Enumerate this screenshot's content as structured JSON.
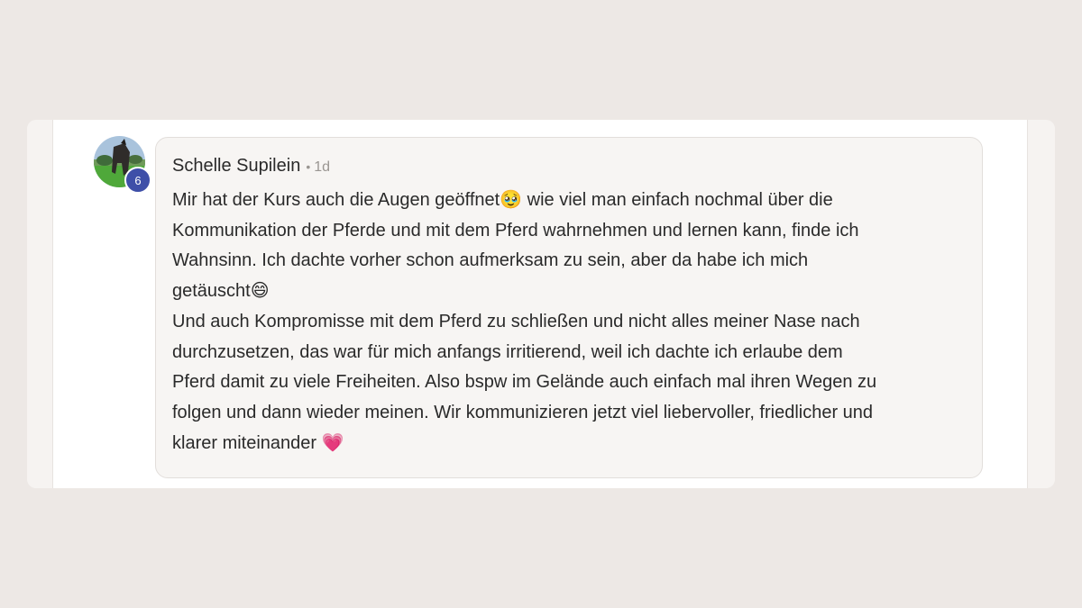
{
  "post": {
    "author": "Schelle Supilein",
    "separator": "•",
    "time": "1d",
    "level": "6",
    "lines": [
      "Mir hat der Kurs auch die Augen geöffnet🥹 wie viel man einfach nochmal über die",
      "Kommunikation der Pferde und mit dem Pferd wahrnehmen und lernen kann, finde ich",
      "Wahnsinn. Ich dachte vorher schon aufmerksam zu sein, aber da habe ich mich",
      "getäuscht😄",
      "Und auch Kompromisse mit dem Pferd zu schließen und nicht alles meiner Nase nach",
      "durchzusetzen, das war für mich anfangs irritierend, weil ich dachte ich erlaube dem",
      "Pferd damit zu viele Freiheiten. Also bspw im Gelände auch einfach mal ihren Wegen zu",
      "folgen und dann wieder meinen. Wir kommunizieren jetzt viel liebervoller, friedlicher und",
      "klarer miteinander 💗"
    ]
  },
  "colors": {
    "page_background": "#ede8e5",
    "badge": "#3e4fa8",
    "bubble": "#f7f5f3"
  }
}
